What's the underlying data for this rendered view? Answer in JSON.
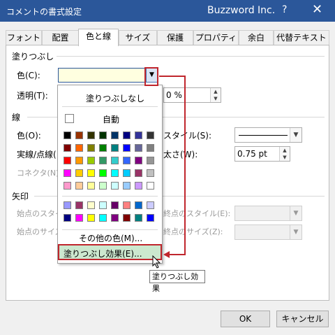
{
  "window": {
    "title": "コメントの書式設定",
    "app": "Buzzword Inc.",
    "help": "?",
    "close": "✕"
  },
  "tabs": [
    {
      "label": "フォント"
    },
    {
      "label": "配置"
    },
    {
      "label": "色と線"
    },
    {
      "label": "サイズ"
    },
    {
      "label": "保護"
    },
    {
      "label": "プロパティ"
    },
    {
      "label": "余白"
    },
    {
      "label": "代替テキスト"
    }
  ],
  "fill": {
    "group": "塗りつぶし",
    "color_label": "色(C):",
    "transparency_label": "透明(T):",
    "transparency_value": "0 %"
  },
  "line": {
    "group": "線",
    "color_label": "色(O):",
    "dash_label": "実線/点線(",
    "connector_label": "コネクタ(N):",
    "style_label": "スタイル(S):",
    "weight_label": "太さ(W):",
    "weight_value": "0.75 pt"
  },
  "arrows": {
    "group": "矢印",
    "begin_style_label": "始点のスタイ",
    "begin_size_label": "始点のサイズ",
    "end_style_label": "終点のスタイル(E):",
    "end_size_label": "終点のサイズ(Z):"
  },
  "popup": {
    "no_fill": "塗りつぶしなし",
    "auto": "自動",
    "more_colors": "その他の色(M)...",
    "fill_effects": "塗りつぶし効果(E)...",
    "palette": [
      [
        "#000000",
        "#993300",
        "#333300",
        "#003300",
        "#003366",
        "#000080",
        "#333399",
        "#333333"
      ],
      [
        "#800000",
        "#ff6600",
        "#808000",
        "#008000",
        "#008080",
        "#0000ff",
        "#666699",
        "#808080"
      ],
      [
        "#ff0000",
        "#ff9900",
        "#99cc00",
        "#339966",
        "#33cccc",
        "#3366ff",
        "#800080",
        "#969696"
      ],
      [
        "#ff00ff",
        "#ffcc00",
        "#ffff00",
        "#00ff00",
        "#00ffff",
        "#00ccff",
        "#993366",
        "#c0c0c0"
      ],
      [
        "#ff99cc",
        "#ffcc99",
        "#ffff99",
        "#ccffcc",
        "#ccffff",
        "#99ccff",
        "#cc99ff",
        "#ffffff"
      ]
    ],
    "palette2": [
      [
        "#9999ff",
        "#993366",
        "#ffffcc",
        "#ccffff",
        "#660066",
        "#ff8080",
        "#0066cc",
        "#ccccff"
      ],
      [
        "#000080",
        "#ff00ff",
        "#ffff00",
        "#00ffff",
        "#800080",
        "#800000",
        "#008080",
        "#0000ff"
      ]
    ]
  },
  "tooltip": "塗りつぶし効果",
  "buttons": {
    "ok": "OK",
    "cancel": "キャンセル"
  },
  "colors": {
    "titlebar": "#2b579a",
    "highlight": "#c0262d",
    "selected_swatch": "#ffffe0"
  }
}
